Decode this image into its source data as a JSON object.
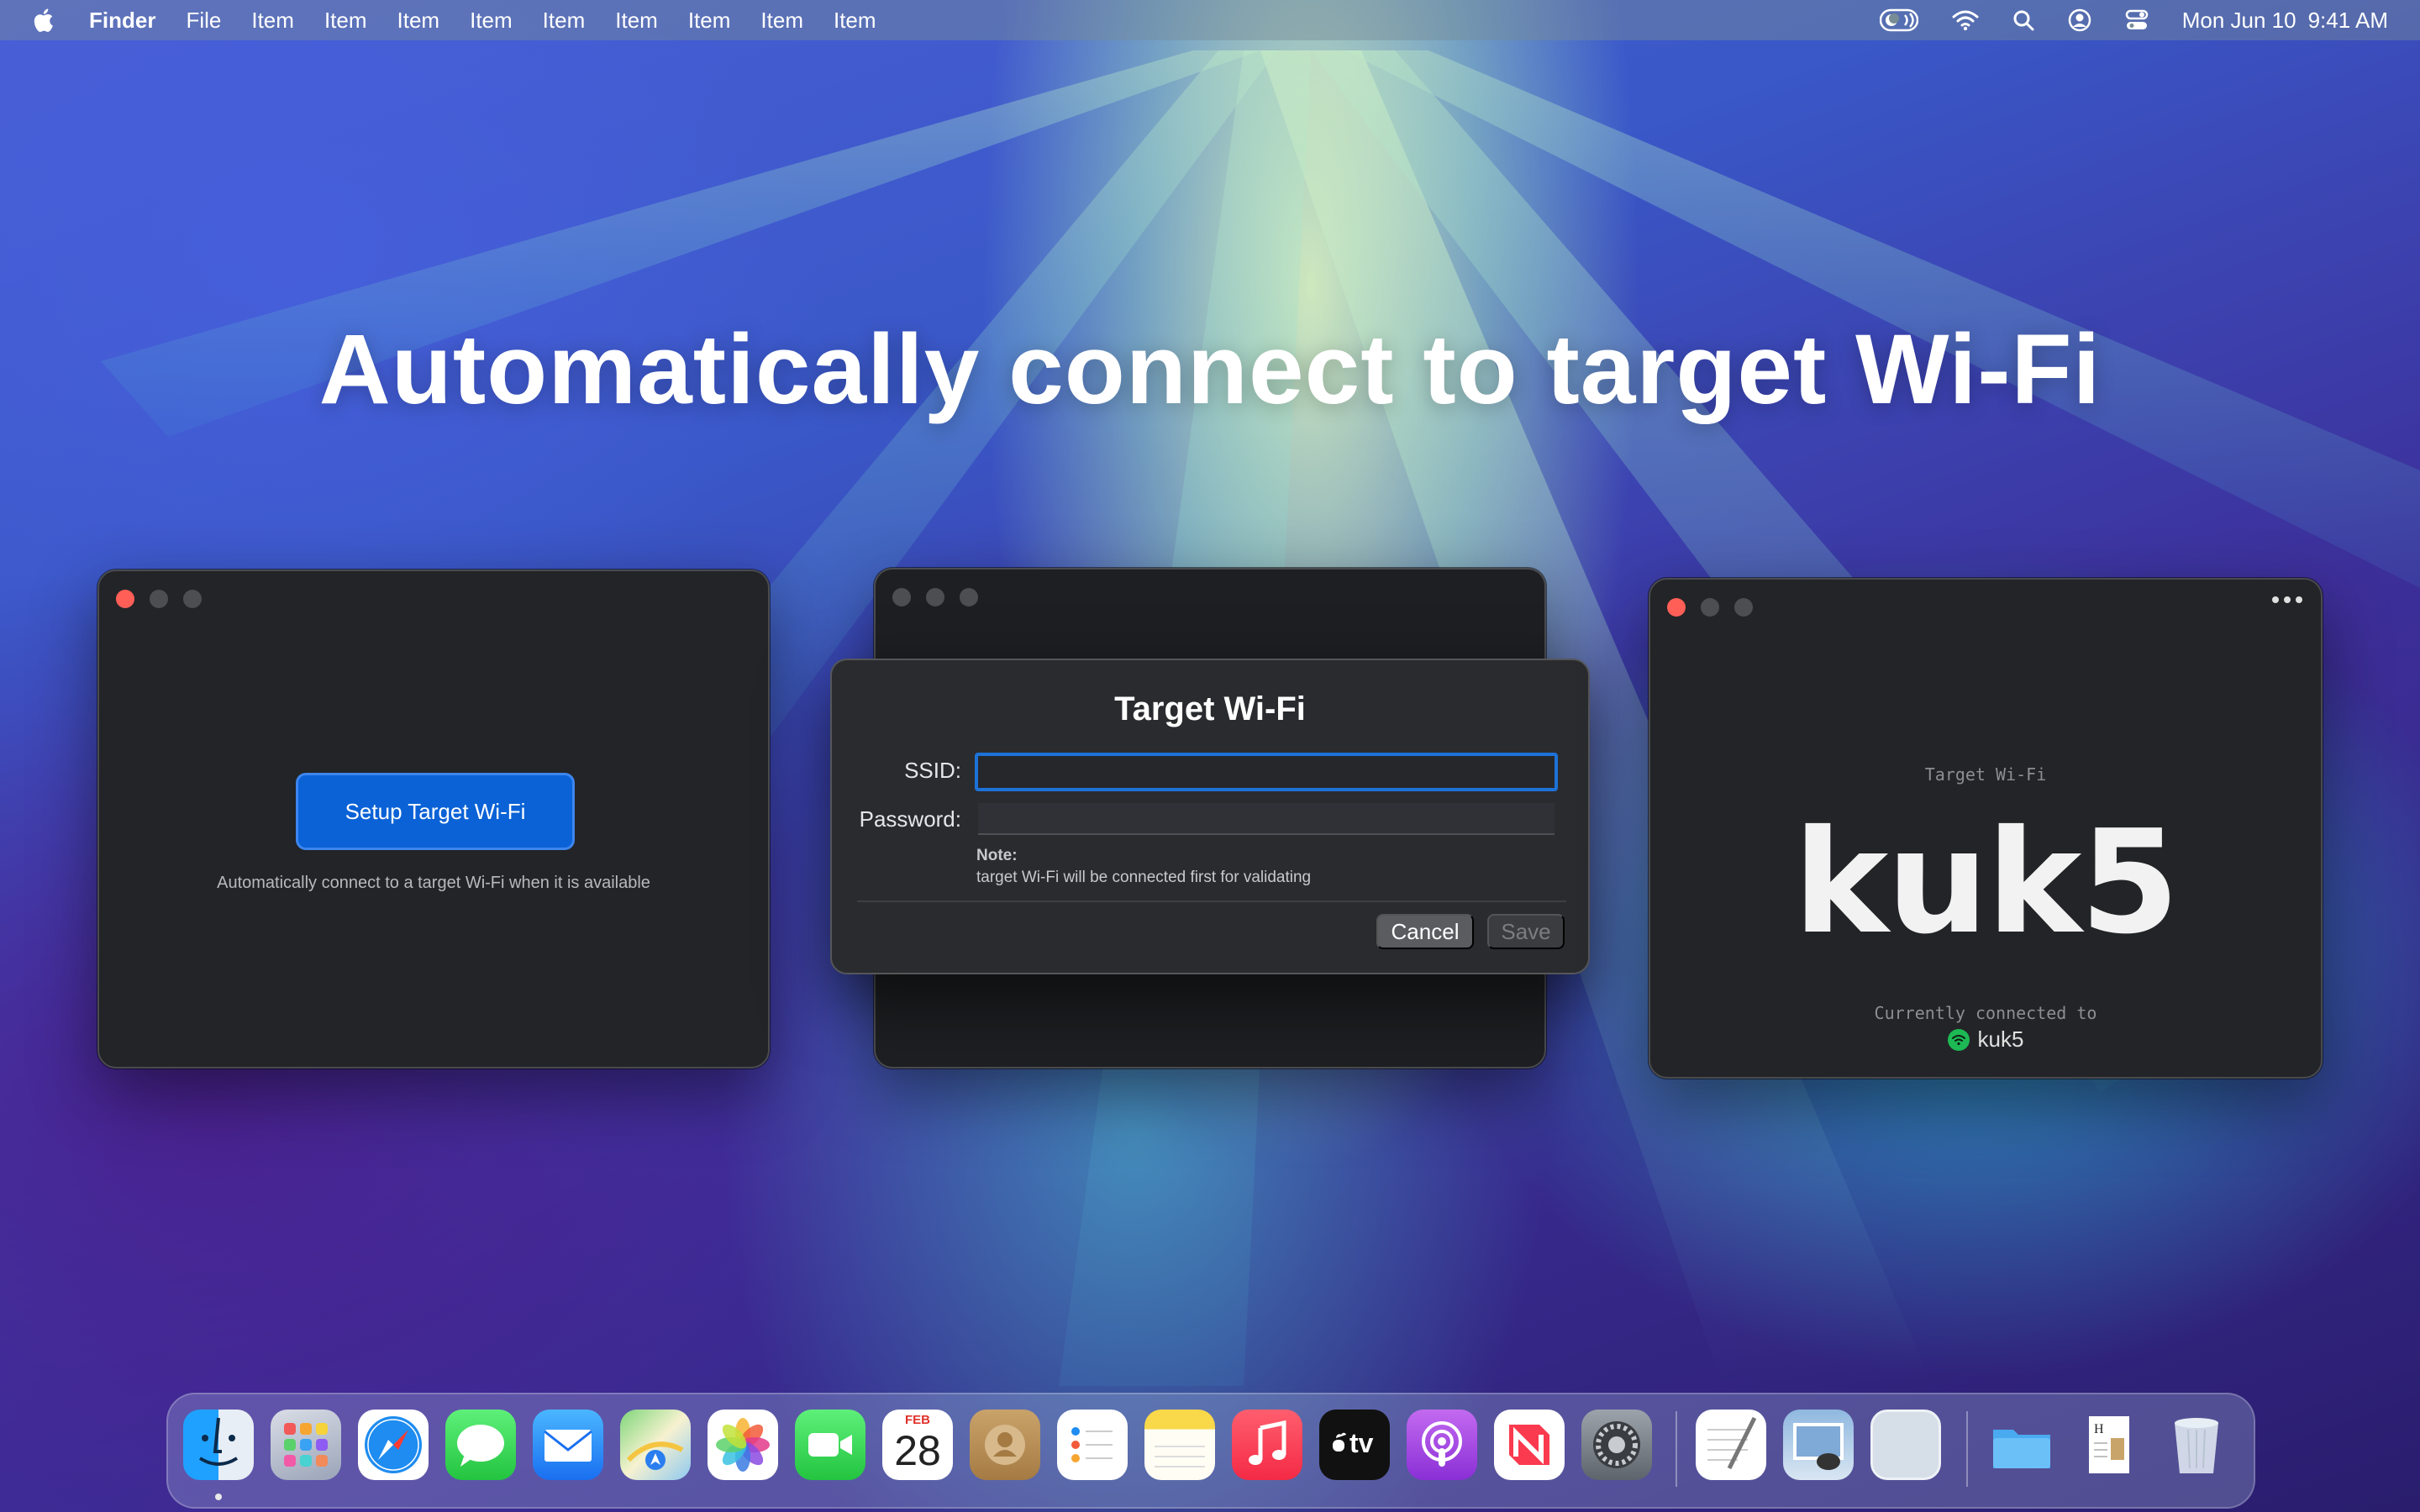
{
  "menubar": {
    "app_name": "Finder",
    "items": [
      "File",
      "Item",
      "Item",
      "Item",
      "Item",
      "Item",
      "Item",
      "Item",
      "Item",
      "Item"
    ],
    "date": "Mon Jun 10",
    "time": "9:41 AM"
  },
  "headline": "Automatically connect to target Wi-Fi",
  "window_setup": {
    "button_label": "Setup Target Wi-Fi",
    "caption": "Automatically connect to a target Wi-Fi when it is available"
  },
  "dialog": {
    "title": "Target Wi-Fi",
    "ssid_label": "SSID:",
    "ssid_value": "",
    "password_label": "Password:",
    "password_value": "",
    "note_title": "Note:",
    "note_text": "target Wi-Fi will be connected first for validating",
    "cancel_label": "Cancel",
    "save_label": "Save"
  },
  "window_status": {
    "label": "Target Wi-Fi",
    "target_ssid": "kuk5",
    "connected_label": "Currently connected to",
    "connected_ssid": "kuk5"
  },
  "dock": {
    "apps": [
      "Finder",
      "Launchpad",
      "Safari",
      "Messages",
      "Mail",
      "Maps",
      "Photos",
      "FaceTime",
      "Calendar",
      "Contacts",
      "Reminders",
      "Notes",
      "Music",
      "TV",
      "Podcasts",
      "News",
      "System Settings",
      "TextEdit",
      "Preview",
      "App",
      "Folder",
      "Document",
      "Trash"
    ],
    "calendar_month": "FEB",
    "calendar_day": "28",
    "tv_label": "tv"
  },
  "colors": {
    "accent": "#0a62d6",
    "window_bg": "#232427",
    "close_red": "#ff5f57",
    "wifi_green": "#1db954"
  }
}
